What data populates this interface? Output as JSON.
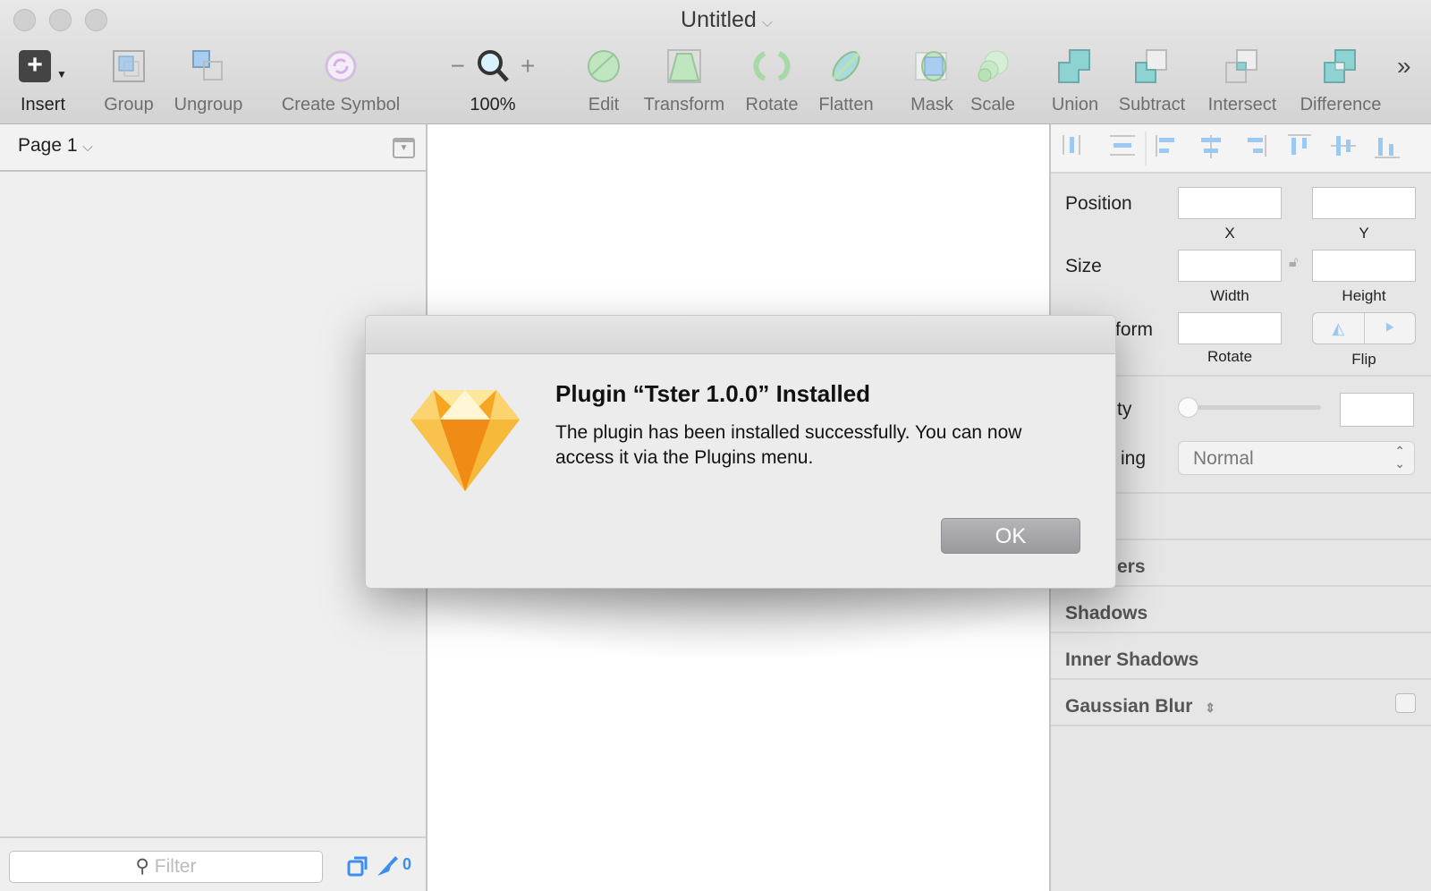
{
  "window": {
    "title": "Untitled"
  },
  "toolbar": {
    "insert": "Insert",
    "group": "Group",
    "ungroup": "Ungroup",
    "create_symbol": "Create Symbol",
    "zoom_level": "100%",
    "edit": "Edit",
    "transform": "Transform",
    "rotate": "Rotate",
    "flatten": "Flatten",
    "mask": "Mask",
    "scale": "Scale",
    "union": "Union",
    "subtract": "Subtract",
    "intersect": "Intersect",
    "difference": "Difference"
  },
  "sidebar": {
    "page": "Page 1",
    "filter_placeholder": "Filter",
    "slice_count": "0"
  },
  "inspector": {
    "position": "Position",
    "x": "X",
    "y": "Y",
    "size": "Size",
    "width": "Width",
    "height": "Height",
    "transform": "form",
    "rotate": "Rotate",
    "flip": "Flip",
    "opacity": "ty",
    "blending": "ing",
    "blend_mode": "Normal",
    "borders": "ers",
    "shadows": "Shadows",
    "inner_shadows": "Inner Shadows",
    "gaussian_blur": "Gaussian Blur",
    "opacity_value": 0
  },
  "dialog": {
    "title": "Plugin “Tster 1.0.0” Installed",
    "message": "The plugin has been installed successfully. You can now access it via the Plugins menu.",
    "ok": "OK"
  },
  "colors": {
    "accent": "#3d8ef0",
    "alignment_icons": "#9cc9f3"
  }
}
